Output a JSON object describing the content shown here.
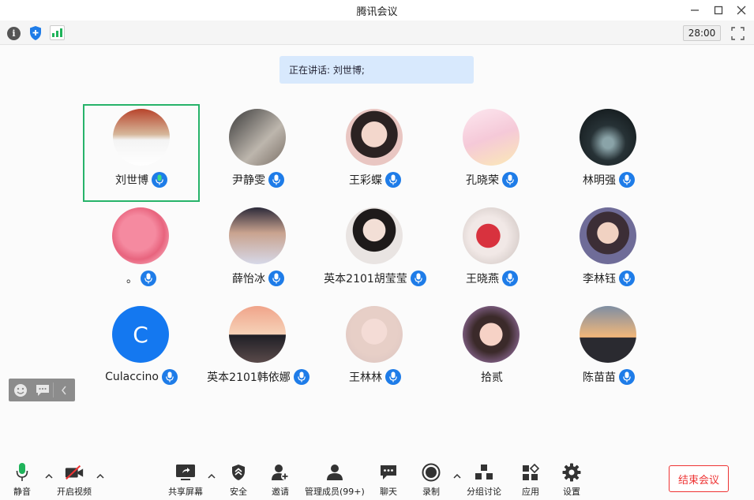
{
  "window": {
    "title": "腾讯会议"
  },
  "infobar": {
    "timer": "28:00"
  },
  "speaking": {
    "text": "正在讲话: 刘世博;"
  },
  "participants": [
    {
      "name": "刘世博",
      "mic": "speaking",
      "active": true
    },
    {
      "name": "尹静雯",
      "mic": "on"
    },
    {
      "name": "王彩蝶",
      "mic": "on"
    },
    {
      "name": "孔晓荣",
      "mic": "on"
    },
    {
      "name": "林明强",
      "mic": "on"
    },
    {
      "name": "。",
      "mic": "on"
    },
    {
      "name": "薛怡冰",
      "mic": "on"
    },
    {
      "name": "英本2101胡莹莹",
      "mic": "on"
    },
    {
      "name": "王晓燕",
      "mic": "on"
    },
    {
      "name": "李林钰",
      "mic": "on"
    },
    {
      "name": "Culaccino",
      "mic": "on",
      "initial": "C"
    },
    {
      "name": "英本2101韩依娜",
      "mic": "on"
    },
    {
      "name": "王林林",
      "mic": "on"
    },
    {
      "name": "拾贰",
      "mic": "none"
    },
    {
      "name": "陈苗苗",
      "mic": "on"
    }
  ],
  "toolbar": {
    "mute": "静音",
    "video": "开启视频",
    "share": "共享屏幕",
    "security": "安全",
    "invite": "邀请",
    "members": "管理成员(99+)",
    "chat": "聊天",
    "record": "录制",
    "breakout": "分组讨论",
    "apps": "应用",
    "settings": "设置",
    "end": "结束会议"
  },
  "colors": {
    "accent": "#1e7ce8",
    "active_border": "#27b36a",
    "end": "#e33333"
  }
}
